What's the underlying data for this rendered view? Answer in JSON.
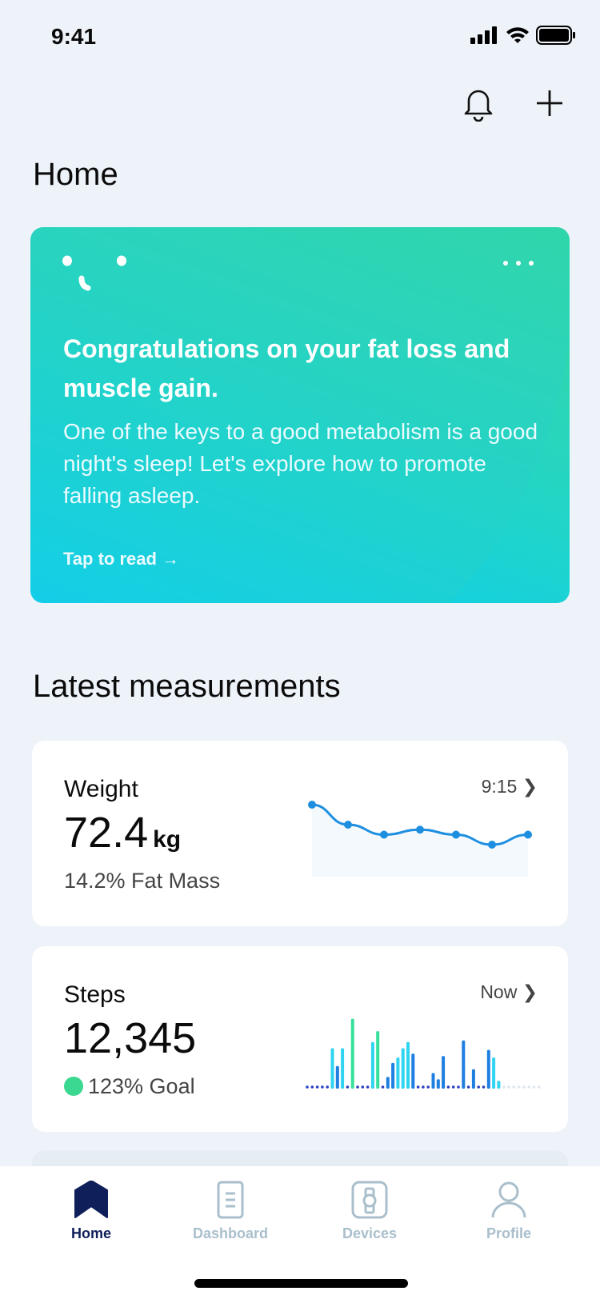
{
  "status": {
    "time": "9:41"
  },
  "header": {
    "title": "Home",
    "icons": [
      "bell-icon",
      "plus-icon"
    ]
  },
  "hero": {
    "title": "Congratulations on your fat loss and muscle gain.",
    "body": "One of the keys to a good metabolism is a good night's sleep! Let's explore how to promote falling asleep.",
    "link": "Tap to read →",
    "colors": [
      "#08cdf8",
      "#35d99a"
    ]
  },
  "section_title": "Latest measurements",
  "weight": {
    "label": "Weight",
    "value": "72.4",
    "unit": "kg",
    "sub": "14.2% Fat Mass",
    "time": "9:15",
    "trend": [
      73.4,
      73.0,
      72.8,
      72.9,
      72.8,
      72.6,
      72.8
    ],
    "color": "#1e8fe0"
  },
  "steps": {
    "label": "Steps",
    "value": "12,345",
    "sub": "123% Goal",
    "time": "Now",
    "goal_color": "#3ad890",
    "bars": [
      0,
      0,
      0,
      0,
      0,
      50,
      27,
      50,
      0,
      88,
      0,
      0,
      0,
      58,
      72,
      0,
      13,
      31,
      38,
      50,
      58,
      43,
      0,
      0,
      0,
      18,
      10,
      40,
      0,
      0,
      0,
      60,
      0,
      23,
      0,
      0,
      48,
      38,
      8
    ],
    "bar_colors": "bbbbbcbcbgbbbcgbbbcccbbbbbbbcbbbgbbbbccb",
    "future_slots": 8,
    "colors": {
      "g": "#34e09c",
      "c": "#2ed4f0",
      "b": "#1e7fe0",
      "dot": "#2b3fc4",
      "future": "#dde5ee"
    }
  },
  "tabs": [
    {
      "label": "Home",
      "active": true
    },
    {
      "label": "Dashboard"
    },
    {
      "label": "Devices"
    },
    {
      "label": "Profile"
    }
  ],
  "accent": "#0f1f5a"
}
